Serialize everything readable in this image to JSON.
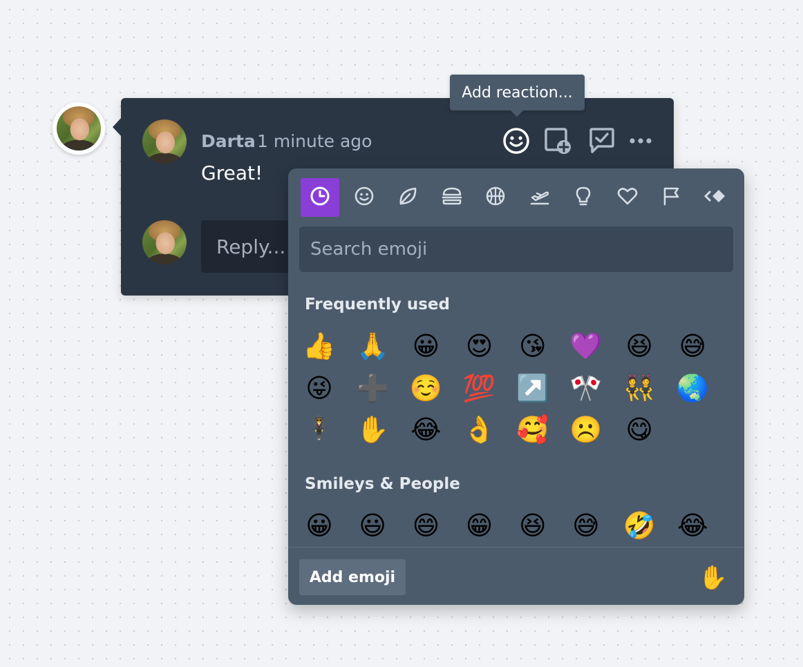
{
  "comment": {
    "author": "Darta",
    "time": "1 minute ago",
    "text": "Great!",
    "actions": [
      {
        "name": "add-reaction",
        "icon": "smile-icon"
      },
      {
        "name": "add-image",
        "icon": "image-plus-icon"
      },
      {
        "name": "resolve",
        "icon": "check-comment-icon"
      },
      {
        "name": "more",
        "icon": "more-icon"
      }
    ]
  },
  "reply": {
    "placeholder": "Reply..."
  },
  "tooltip": {
    "text": "Add reaction..."
  },
  "emoji_picker": {
    "categories": [
      {
        "name": "recent",
        "icon": "clock-icon",
        "active": true
      },
      {
        "name": "smileys",
        "icon": "smiley-icon"
      },
      {
        "name": "nature",
        "icon": "leaf-icon"
      },
      {
        "name": "food",
        "icon": "burger-icon"
      },
      {
        "name": "activity",
        "icon": "basketball-icon"
      },
      {
        "name": "travel",
        "icon": "plane-icon"
      },
      {
        "name": "objects",
        "icon": "lightbulb-icon"
      },
      {
        "name": "symbols",
        "icon": "heart-icon"
      },
      {
        "name": "flags",
        "icon": "flag-icon"
      },
      {
        "name": "custom",
        "icon": "custom-icon"
      }
    ],
    "search_placeholder": "Search emoji",
    "sections": [
      {
        "title": "Frequently used",
        "emojis": [
          "👍",
          "🙏",
          "😀",
          "😍",
          "😘",
          "💜",
          "😆",
          "😅",
          "😜",
          "➕",
          "☺️",
          "💯",
          "↗️",
          "🎌",
          "👯",
          "🌏",
          "🕴️",
          "✋",
          "😂",
          "👌",
          "🥰",
          "☹️",
          "😋"
        ]
      },
      {
        "title": "Smileys & People",
        "emojis": [
          "😀",
          "😃",
          "😄",
          "😁",
          "😆",
          "😅",
          "🤣",
          "😂"
        ]
      }
    ],
    "add_emoji_label": "Add emoji",
    "skin_tone_emoji": "✋"
  },
  "colors": {
    "card_bg": "#2b3644",
    "picker_bg": "#4b5b6b",
    "active_tab": "#8a3ed8",
    "tooltip_bg": "#4a5a6b"
  }
}
